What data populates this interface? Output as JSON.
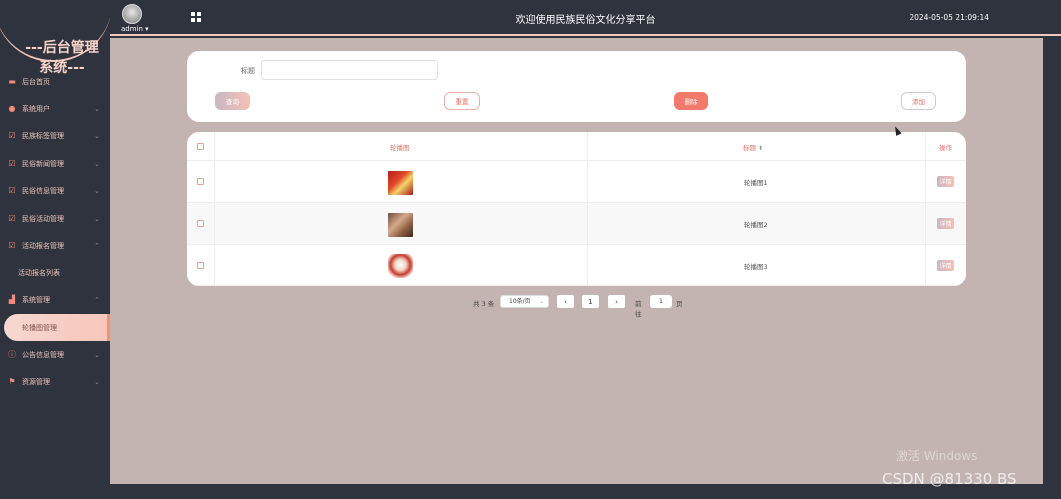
{
  "sidebar": {
    "logo_line1": "---后台管理",
    "logo_line2": "系统---",
    "items": [
      {
        "label": "后台首页",
        "icon": "monitor-icon"
      },
      {
        "label": "系统用户",
        "icon": "user-icon"
      },
      {
        "label": "民族标签管理",
        "icon": "checklist-icon"
      },
      {
        "label": "民俗新闻管理",
        "icon": "checklist-icon"
      },
      {
        "label": "民俗信息管理",
        "icon": "checklist-icon"
      },
      {
        "label": "民俗活动管理",
        "icon": "checklist-icon"
      },
      {
        "label": "活动报名管理",
        "icon": "checklist-icon"
      },
      {
        "label": "系统管理",
        "icon": "chart-icon"
      },
      {
        "label": "公告信息管理",
        "icon": "info-icon"
      },
      {
        "label": "资源管理",
        "icon": "flag-icon"
      }
    ],
    "sub_activity": "活动报名列表",
    "sub_system": "轮播图管理"
  },
  "header": {
    "user": "admin",
    "title": "欢迎使用民族民俗文化分享平台",
    "datetime": "2024-05-05 21:09:14"
  },
  "search": {
    "label": "标题",
    "value": "",
    "placeholder": ""
  },
  "buttons": {
    "query": "查询",
    "reset": "重置",
    "delete": "删除",
    "add": "添加"
  },
  "table": {
    "columns": [
      "轮播图",
      "标题",
      "操作"
    ],
    "rows": [
      {
        "title": "轮播图1",
        "action": "详情"
      },
      {
        "title": "轮播图2",
        "action": "详情"
      },
      {
        "title": "轮播图3",
        "action": "详情"
      }
    ]
  },
  "pagination": {
    "total": "共 3 条",
    "page_size": "10条/页",
    "current": "1",
    "goto_label": "前往",
    "goto_value": "1",
    "page_unit": "页"
  },
  "watermark": {
    "activate": "激活 Windows",
    "csdn": "CSDN @81330 BS"
  },
  "colors": {
    "sidebar_bg": "#2f333d",
    "accent": "#f2c7bd",
    "main_bg": "#c4b4b1",
    "danger": "#f27a6d"
  }
}
